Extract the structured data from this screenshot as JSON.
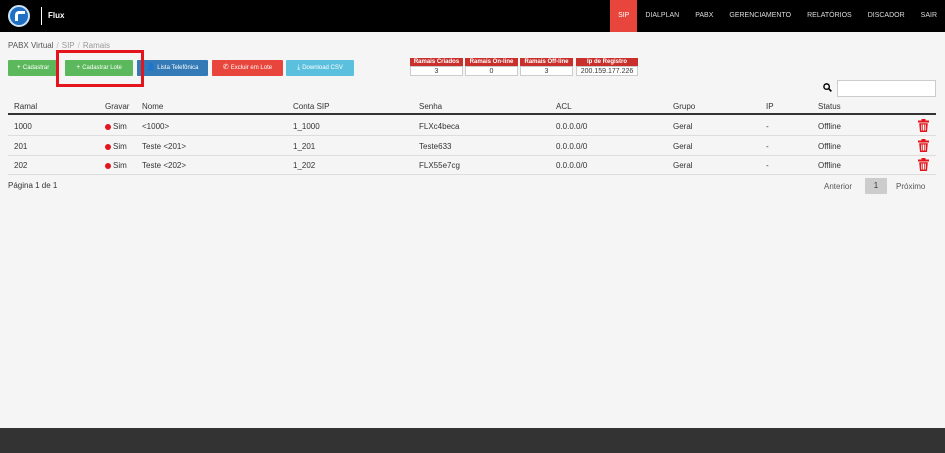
{
  "header": {
    "brand": "Flux",
    "nav": [
      "SIP",
      "DIALPLAN",
      "PABX",
      "GERENCIAMENTO",
      "RELATÓRIOS",
      "DISCADOR",
      "SAIR"
    ],
    "active_nav": "SIP"
  },
  "breadcrumb": [
    "PABX Virtual",
    "SIP",
    "Ramais"
  ],
  "toolbar": {
    "cadastrar": "Cadastrar",
    "cadastrar_lote": "Cadastrar Lote",
    "lista_telefonica": "Lista Telefônica",
    "excluir_lote": "Excluir em Lote",
    "download_csv": "Download CSV"
  },
  "stats": [
    {
      "label": "Ramais Criados",
      "value": "3"
    },
    {
      "label": "Ramais On-line",
      "value": "0"
    },
    {
      "label": "Ramais Off-line",
      "value": "3"
    },
    {
      "label": "Ip de Registro",
      "value": "200.159.177.226"
    }
  ],
  "search": {
    "placeholder": ""
  },
  "table": {
    "columns": [
      "Ramal",
      "Gravar",
      "Nome",
      "Conta SIP",
      "Senha",
      "ACL",
      "Grupo",
      "IP",
      "Status"
    ],
    "rows": [
      {
        "ramal": "1000",
        "gravar": "Sim",
        "nome": "<1000>",
        "conta": "1_1000",
        "senha": "FLXc4beca",
        "acl": "0.0.0.0/0",
        "grupo": "Geral",
        "ip": "-",
        "status": "Offline"
      },
      {
        "ramal": "201",
        "gravar": "Sim",
        "nome": "Teste <201>",
        "conta": "1_201",
        "senha": "Teste633",
        "acl": "0.0.0.0/0",
        "grupo": "Geral",
        "ip": "-",
        "status": "Offline"
      },
      {
        "ramal": "202",
        "gravar": "Sim",
        "nome": "Teste <202>",
        "conta": "1_202",
        "senha": "FLX55e7cg",
        "acl": "0.0.0.0/0",
        "grupo": "Geral",
        "ip": "-",
        "status": "Offline"
      }
    ]
  },
  "pagination": {
    "info": "Página 1 de 1",
    "prev": "Anterior",
    "current": "1",
    "next": "Próximo"
  },
  "colors": {
    "accent": "#e8453c",
    "success": "#5cb85c",
    "primary": "#337ab7",
    "info": "#5bc0de",
    "highlight": "#e3141b"
  }
}
